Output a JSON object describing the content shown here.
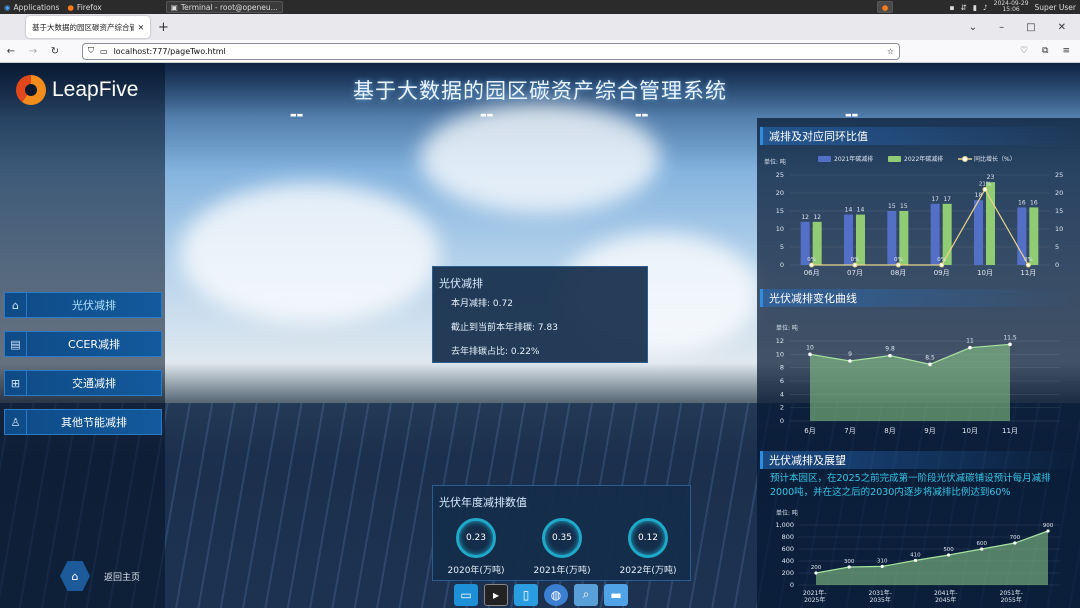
{
  "system_bar": {
    "applications": "Applications",
    "firefox_task": "Firefox",
    "terminal_task": "Terminal - root@openeu...",
    "date": "2024-09-29",
    "time": "15:06",
    "user": "Super User"
  },
  "browser": {
    "tab_title": "基于大数据的园区碳资产综合管",
    "url": "localhost:777/pageTwo.html"
  },
  "page": {
    "logo_text": "LeapFive",
    "title": "基于大数据的园区碳资产综合管理系统",
    "menu": [
      {
        "label": "光伏减排",
        "icon": "solar-icon"
      },
      {
        "label": "CCER减排",
        "icon": "document-icon"
      },
      {
        "label": "交通减排",
        "icon": "grid-icon"
      },
      {
        "label": "其他节能减排",
        "icon": "person-icon"
      }
    ],
    "home_label": "返回主页",
    "popup": {
      "title": "光伏减排",
      "rows": [
        "本月减排: 0.72",
        "截止到当前本年排碳: 7.83",
        "去年排碳占比: 0.22%"
      ]
    },
    "annual": {
      "title": "光伏年度减排数值",
      "items": [
        {
          "value": "0.23",
          "label": "2020年(万吨)"
        },
        {
          "value": "0.35",
          "label": "2021年(万吨)"
        },
        {
          "value": "0.12",
          "label": "2022年(万吨)"
        }
      ]
    },
    "panel1_title": "减排及对应同环比值",
    "panel2_title": "光伏减排变化曲线",
    "panel3_title": "光伏减排及展望",
    "outlook_text": "预计本园区，在2025之前完成第一阶段光伏减碳铺设预计每月减排2000吨，并在这之后的2030内逐步将减排比例达到60%",
    "colors": {
      "bar2021": "#5470c6",
      "bar2022": "#91cc75",
      "line": "#e8d48a",
      "area": "#8fd08a"
    }
  },
  "chart_data": [
    {
      "type": "bar",
      "title": "减排及对应同环比值",
      "unit_label": "单位: 吨",
      "categories": [
        "06月",
        "07月",
        "08月",
        "09月",
        "10月",
        "11月"
      ],
      "series": [
        {
          "name": "2021年碳减排",
          "values": [
            12,
            14,
            15,
            17,
            18,
            16
          ]
        },
        {
          "name": "2022年碳减排",
          "values": [
            12,
            14,
            15,
            17,
            23,
            16
          ]
        },
        {
          "name": "同比增长（%）",
          "type": "line",
          "values": [
            0,
            0,
            0,
            0,
            21,
            0
          ]
        }
      ],
      "data_labels_line": [
        "0%",
        "0%",
        "0%",
        "0%",
        "21%",
        "0%"
      ],
      "ylim": [
        0,
        25
      ],
      "yticks": [
        0,
        5,
        10,
        15,
        20,
        25
      ],
      "legend": "top"
    },
    {
      "type": "area",
      "title": "光伏减排变化曲线",
      "unit_label": "单位: 吨",
      "categories": [
        "6月",
        "7月",
        "8月",
        "9月",
        "10月",
        "11月"
      ],
      "values": [
        10,
        9,
        9.8,
        8.5,
        11,
        11.5
      ],
      "ylim": [
        0,
        12
      ],
      "yticks": [
        0,
        2,
        4,
        6,
        8,
        10,
        12
      ]
    },
    {
      "type": "area",
      "title": "光伏减排及展望",
      "unit_label": "单位: 吨",
      "categories": [
        "2021年-2025年",
        "2031年-2035年",
        "2041年-2045年",
        "2051年-2055年"
      ],
      "x_points": 9,
      "values": [
        200,
        300,
        310,
        410,
        500,
        600,
        700,
        900
      ],
      "ylim": [
        0,
        1000
      ],
      "yticks": [
        "0",
        "200",
        "400",
        "600",
        "800",
        "1,000"
      ]
    }
  ]
}
